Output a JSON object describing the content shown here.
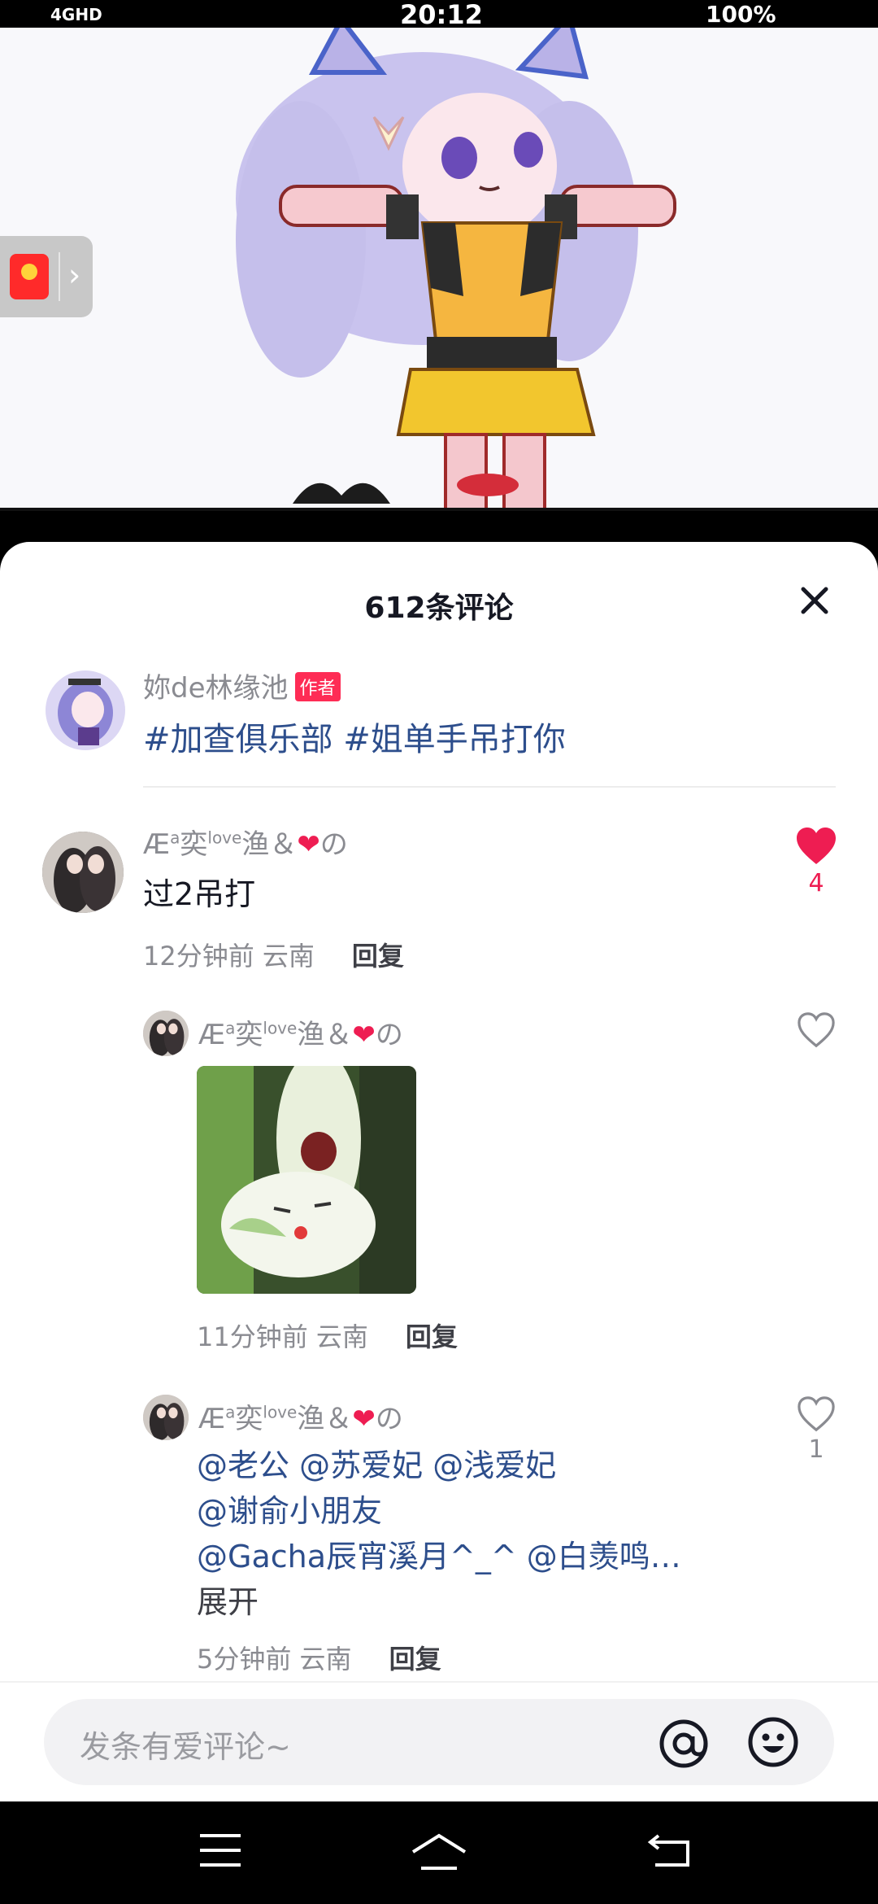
{
  "status_bar": {
    "time": "20:12",
    "network": "4GHD",
    "battery": "100%"
  },
  "sheet": {
    "title": "612条评论"
  },
  "author_comment": {
    "username": "妳de林缘池",
    "badge": "作者",
    "tags": [
      "#加查俱乐部",
      "#姐单手吊打你"
    ]
  },
  "comment1": {
    "username_prefix": "Æ",
    "username_a": "a",
    "username_mid": "奕",
    "username_love": "love",
    "username_suffix": "渔＆",
    "username_end": "の",
    "text": "过2吊打",
    "time": "12分钟前",
    "location": "云南",
    "reply_label": "回复",
    "likes": "4"
  },
  "reply1": {
    "username_prefix": "Æ",
    "username_a": "a",
    "username_mid": "奕",
    "username_love": "love",
    "username_suffix": "渔＆",
    "username_end": "の",
    "time": "11分钟前",
    "location": "云南",
    "reply_label": "回复"
  },
  "reply2": {
    "username_prefix": "Æ",
    "username_a": "a",
    "username_mid": "奕",
    "username_love": "love",
    "username_suffix": "渔＆",
    "username_end": "の",
    "line1": [
      "@老公",
      "@苏爱妃",
      "@浅爱妃"
    ],
    "line2": [
      "@谢俞小朋友"
    ],
    "line3": [
      "@Gacha辰宵溪月^_^",
      "@白羡鸣…"
    ],
    "expand_label": "展开",
    "time": "5分钟前",
    "location": "云南",
    "reply_label": "回复",
    "likes": "1"
  },
  "input": {
    "placeholder": "发条有爱评论~"
  },
  "colors": {
    "like_red": "#ee1d52",
    "tag_blue": "#2d4e8c",
    "badge_pink": "#fe2c55"
  }
}
